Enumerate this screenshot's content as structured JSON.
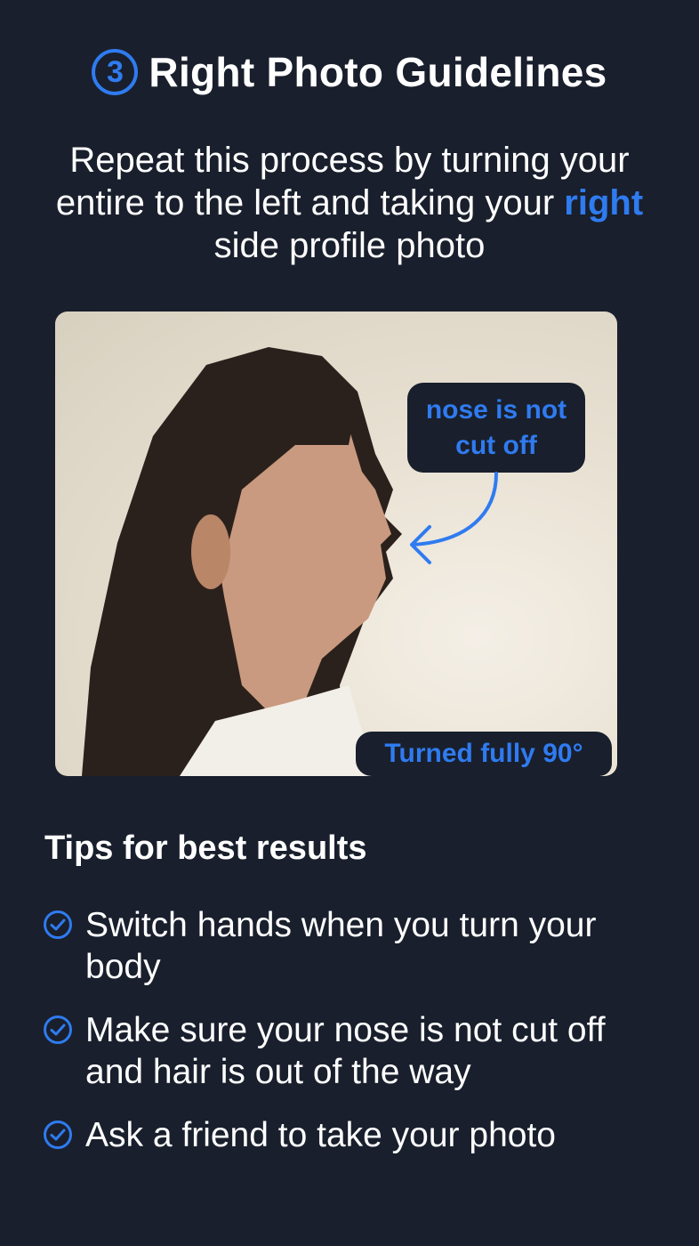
{
  "header": {
    "step_number": "3",
    "title": "Right Photo Guidelines"
  },
  "subtitle": {
    "before": "Repeat this process by turning your entire to the left and taking your ",
    "highlight": "right",
    "after": " side profile photo"
  },
  "photo": {
    "callout": "nose is not cut off",
    "badge": "Turned fully 90°"
  },
  "tips": {
    "heading": "Tips for best results",
    "items": [
      {
        "label": "Switch hands when you turn your body",
        "icon": "check-circle-icon"
      },
      {
        "label": "Make sure your nose is not cut off and hair is out of the way",
        "icon": "check-circle-icon"
      },
      {
        "label": "Ask a friend to take your photo",
        "icon": "check-circle-icon"
      }
    ]
  },
  "colors": {
    "background": "#191f2c",
    "accent": "#2f7bf0",
    "text": "#ffffff"
  }
}
